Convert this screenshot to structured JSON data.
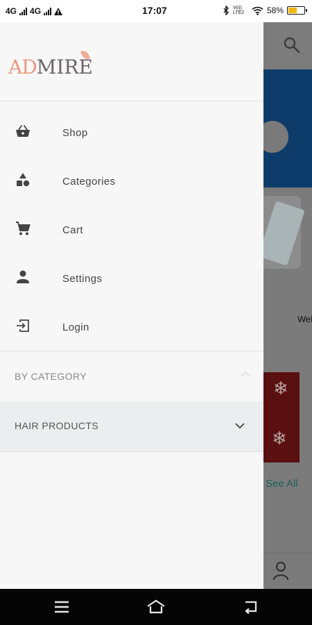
{
  "status_bar": {
    "net1": "4G",
    "net2": "4G",
    "time": "17:07",
    "volte": "Vo)) LTE2",
    "battery": "58%",
    "battery_level": 0.58,
    "icons": [
      "signal-icon",
      "signal-icon",
      "warning-icon",
      "bluetooth-icon",
      "wifi-icon",
      "battery-icon"
    ]
  },
  "drawer": {
    "logo_prefix": "AD",
    "logo_suffix": "MIRE",
    "menu": [
      {
        "label": "Shop",
        "icon": "basket-icon"
      },
      {
        "label": "Categories",
        "icon": "shapes-icon"
      },
      {
        "label": "Cart",
        "icon": "cart-icon"
      },
      {
        "label": "Settings",
        "icon": "person-icon"
      },
      {
        "label": "Login",
        "icon": "login-icon"
      }
    ],
    "section_title": "BY CATEGORY",
    "categories": [
      {
        "label": "HAIR PRODUCTS"
      }
    ]
  },
  "background": {
    "partial_text": "Wel",
    "see_all": "See All"
  },
  "colors": {
    "logo_accent": "#ec9a7e",
    "drawer_bg": "#f7f7f7",
    "category_row_bg": "#ecedee",
    "see_all": "#1d6158"
  }
}
